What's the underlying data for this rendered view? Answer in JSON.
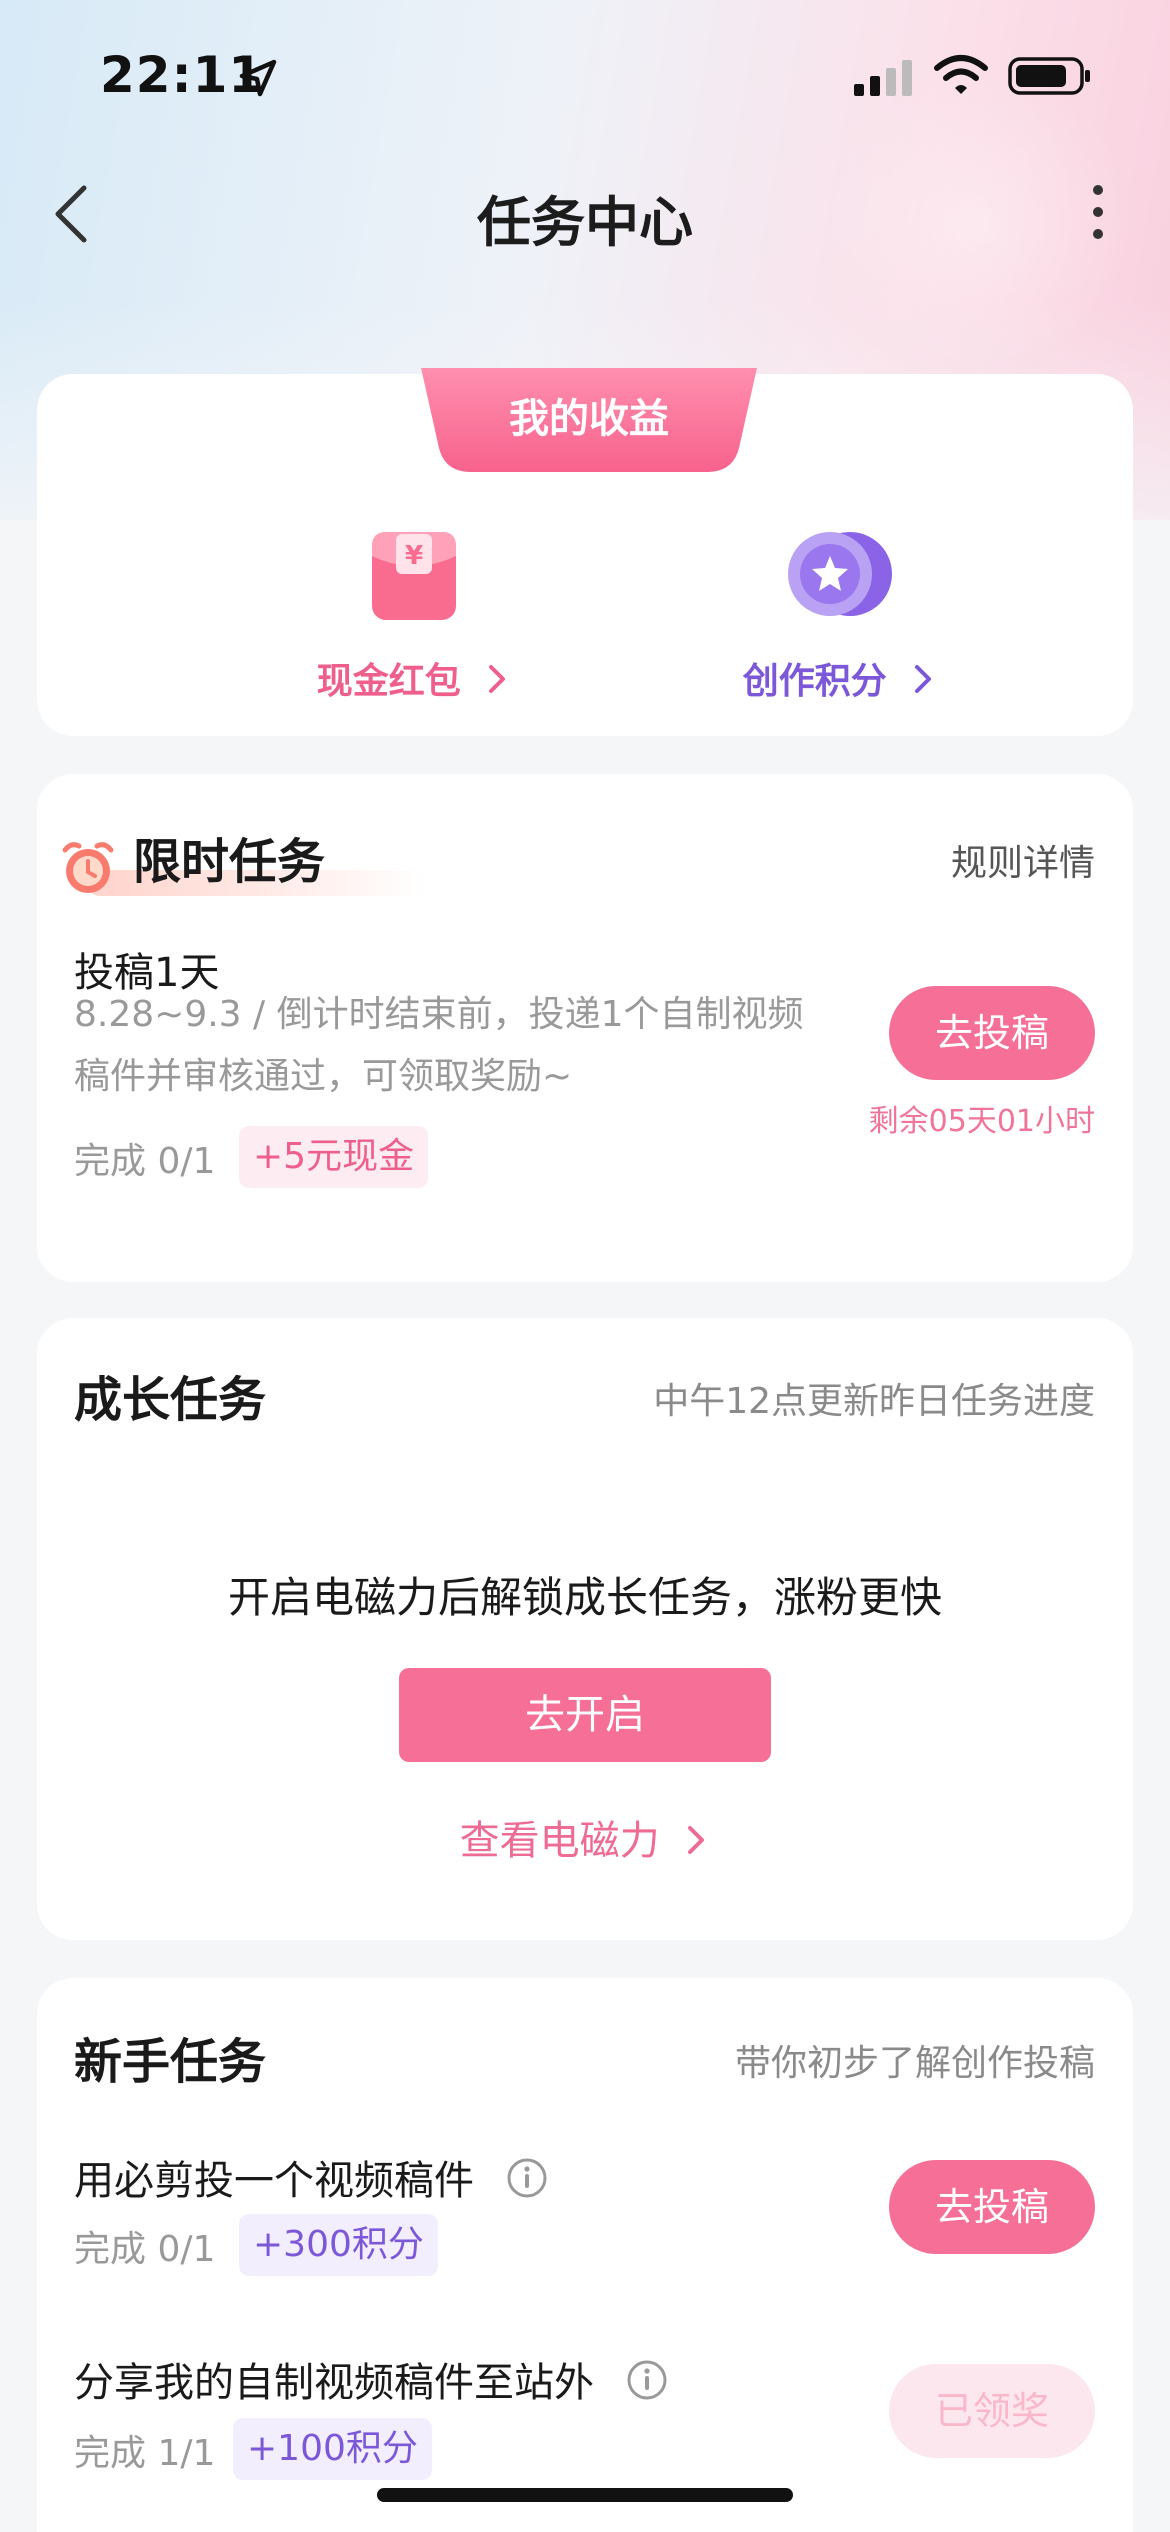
{
  "status_bar": {
    "time": "22:11"
  },
  "nav": {
    "title": "任务中心"
  },
  "earnings": {
    "tab_label": "我的收益",
    "cash_label": "现金红包",
    "points_label": "创作积分"
  },
  "limited": {
    "title": "限时任务",
    "rules_link": "规则详情",
    "task_name": "投稿1天",
    "task_desc_line1": "8.28~9.3 / 倒计时结束前，投递1个自制视频",
    "task_desc_line2": "稿件并审核通过，可领取奖励~",
    "progress": "完成 0/1",
    "reward": "+5元现金",
    "button": "去投稿",
    "remaining": "剩余05天01小时"
  },
  "growth": {
    "title": "成长任务",
    "subtitle": "中午12点更新昨日任务进度",
    "message": "开启电磁力后解锁成长任务，涨粉更快",
    "enable_button": "去开启",
    "view_link": "查看电磁力"
  },
  "newbie": {
    "title": "新手任务",
    "subtitle": "带你初步了解创作投稿",
    "tasks": [
      {
        "name": "用必剪投一个视频稿件",
        "progress": "完成 0/1",
        "reward": "+300积分",
        "button": "去投稿"
      },
      {
        "name": "分享我的自制视频稿件至站外",
        "progress": "完成 1/1",
        "reward": "+100积分",
        "button": "已领奖"
      }
    ]
  },
  "colors": {
    "accent_pink": "#f66f96",
    "accent_purple": "#7c58d9",
    "background": "#f5f6f8"
  }
}
